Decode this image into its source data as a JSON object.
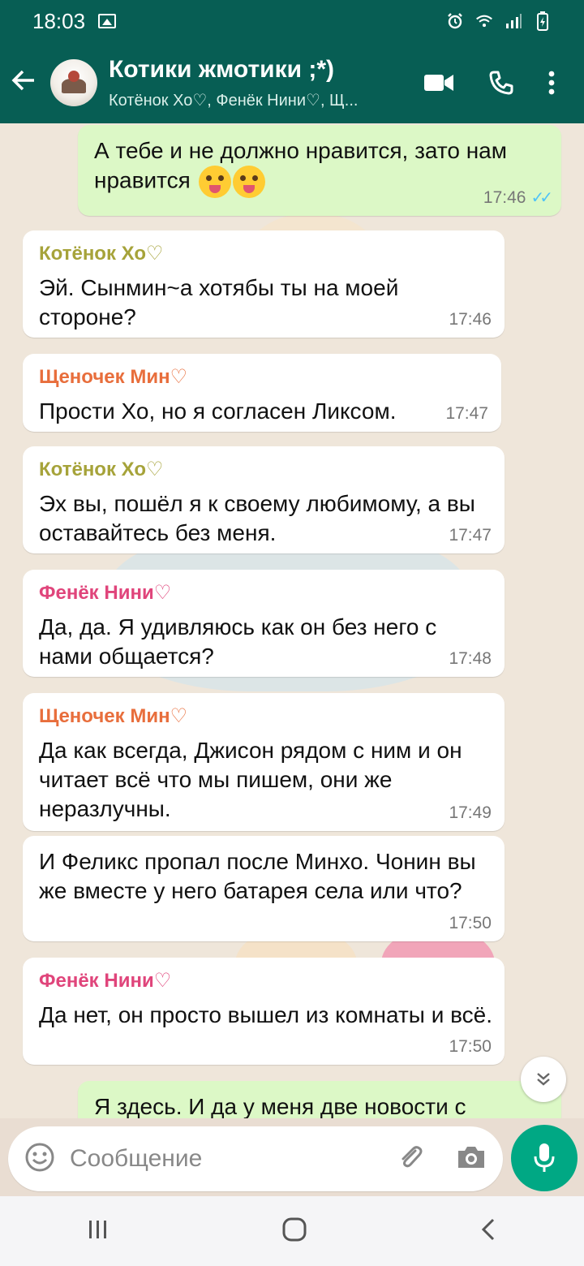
{
  "statusbar": {
    "time": "18:03"
  },
  "header": {
    "title": "Котики жмотики ;*)",
    "subtitle": "Котёнок Хо♡, Фенёк Нини♡, Щ..."
  },
  "messages": [
    {
      "direction": "out",
      "text_line1": "А тебе и не должно нравится, зато нам",
      "text_line2": "нравится",
      "time": "17:46"
    },
    {
      "direction": "in",
      "sender": "Котёнок Хо♡",
      "sender_color": "#a6a33a",
      "text": "Эй. Сынмин~а хотябы ты на моей стороне?",
      "time": "17:46"
    },
    {
      "direction": "in",
      "sender": "Щеночек Мин♡",
      "sender_color": "#e86e3c",
      "text": "Прости Хо, но я согласен Ликсом.",
      "time": "17:47"
    },
    {
      "direction": "in",
      "sender": "Котёнок Хо♡",
      "sender_color": "#a6a33a",
      "text": "Эх вы, пошёл я к своему любимому, а вы оставайтесь без меня.",
      "time": "17:47"
    },
    {
      "direction": "in",
      "sender": "Фенёк Нини♡",
      "sender_color": "#e0457b",
      "text": "Да, да. Я удивляюсь как он без него с нами общается?",
      "time": "17:48"
    },
    {
      "direction": "in",
      "sender": "Щеночек Мин♡",
      "sender_color": "#e86e3c",
      "text": "Да как всегда, Джисон рядом с ним и он читает всё что мы пишем, они же неразлучны.",
      "time": "17:49"
    },
    {
      "direction": "in",
      "text": "И Феликс пропал после Минхо. Чонин вы же вместе у него батарея села или что?",
      "time": "17:50"
    },
    {
      "direction": "in",
      "sender": "Фенёк Нини♡",
      "sender_color": "#e0457b",
      "text": "Да нет, он просто вышел из комнаты и всё.",
      "time": "17:50"
    },
    {
      "direction": "out",
      "text": "Я здесь. И да у меня две новости с"
    }
  ],
  "input": {
    "placeholder": "Сообщение"
  },
  "icons": {
    "back": "arrow-left-icon",
    "video": "video-camera-icon",
    "call": "phone-icon",
    "more": "more-vert-icon",
    "emoji": "smiley-icon",
    "attach": "paperclip-icon",
    "camera": "camera-icon",
    "mic": "microphone-icon"
  },
  "colors": {
    "header": "#075e54",
    "outgoing": "#dcf8c6",
    "accent": "#00a884"
  }
}
